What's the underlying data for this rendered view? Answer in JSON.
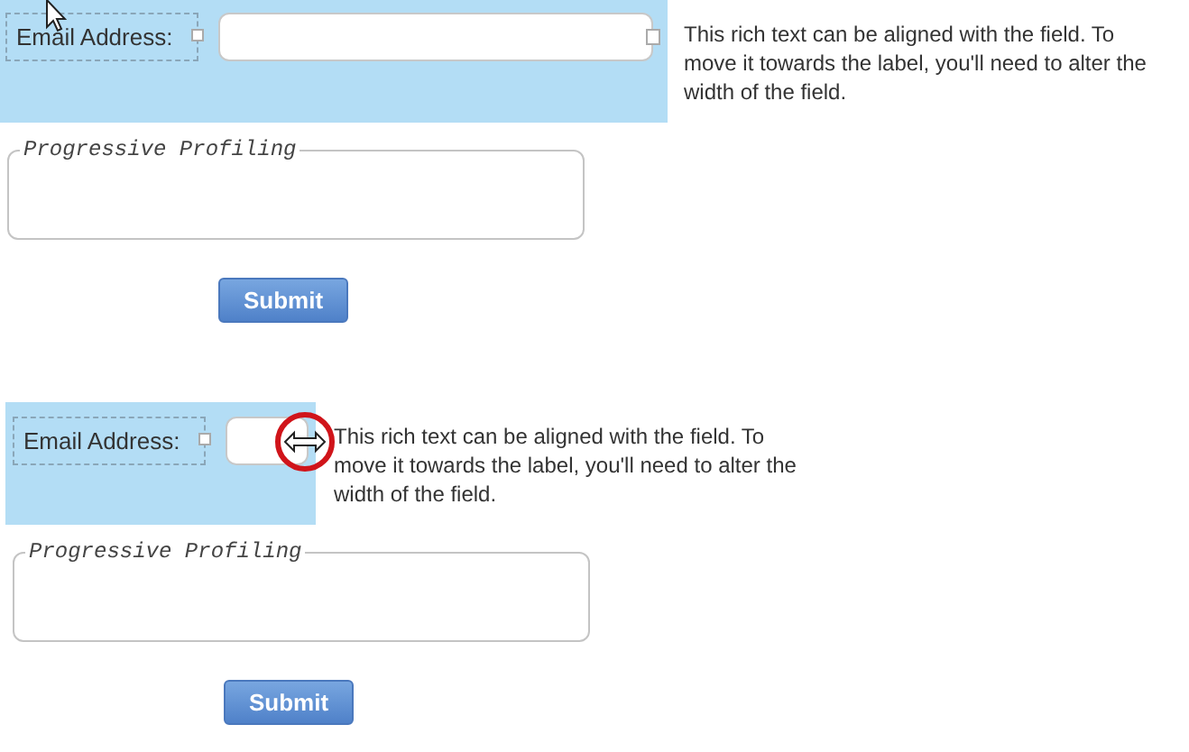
{
  "forms": [
    {
      "kind": "wide",
      "label": "Email Address:",
      "rich_text": "This rich text can be aligned with the field. To move it towards the label, you'll need to alter the width of the field.",
      "fieldset_legend": "Progressive Profiling",
      "submit": "Submit"
    },
    {
      "kind": "narrow",
      "label": "Email Address:",
      "rich_text": "This rich text can be aligned with the field. To move it towards the label, you'll need to alter the width of the field.",
      "fieldset_legend": "Progressive Profiling",
      "submit": "Submit"
    }
  ]
}
